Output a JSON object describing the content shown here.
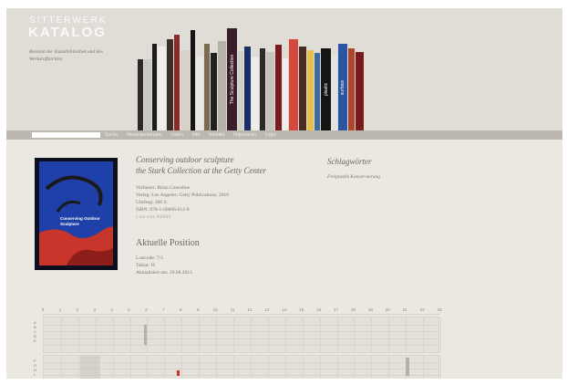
{
  "header": {
    "brand_line1": "SITTERWERK",
    "brand_line2": "KATALOG",
    "tagline": "Bestand der Kunstbibliothek und des Werkstoffarchivs"
  },
  "shelf_books": [
    {
      "color": "#2a2a2a",
      "label": ""
    },
    {
      "color": "#c9c7c2",
      "label": ""
    },
    {
      "color": "#1c1c1c",
      "label": ""
    },
    {
      "color": "#efeeea",
      "label": ""
    },
    {
      "color": "#3a2e25",
      "label": ""
    },
    {
      "color": "#8a2a2a",
      "label": ""
    },
    {
      "color": "#d7d3ca",
      "label": ""
    },
    {
      "color": "#141414",
      "label": ""
    },
    {
      "color": "#e9e7e2",
      "label": ""
    },
    {
      "color": "#7a6a50",
      "label": ""
    },
    {
      "color": "#20201e",
      "label": ""
    },
    {
      "color": "#b8b3a8",
      "label": ""
    },
    {
      "color": "#3a1f2a",
      "label": "The Sculpture Collection"
    },
    {
      "color": "#d1cfca",
      "label": ""
    },
    {
      "color": "#1a2f6a",
      "label": ""
    },
    {
      "color": "#efedea",
      "label": ""
    },
    {
      "color": "#2c2b28",
      "label": ""
    },
    {
      "color": "#c7c4bd",
      "label": ""
    },
    {
      "color": "#7a1c1c",
      "label": ""
    },
    {
      "color": "#efeeeb",
      "label": ""
    },
    {
      "color": "#d6483d",
      "label": ""
    },
    {
      "color": "#4a2a25",
      "label": ""
    },
    {
      "color": "#e2c24a",
      "label": ""
    },
    {
      "color": "#3b6ba0",
      "label": ""
    },
    {
      "color": "#151515",
      "label": "plastic"
    },
    {
      "color": "#e5e3de",
      "label": ""
    },
    {
      "color": "#2a55a2",
      "label": "surface"
    },
    {
      "color": "#b0452d",
      "label": ""
    },
    {
      "color": "#7a1a1a",
      "label": ""
    }
  ],
  "nav": {
    "search_placeholder": "",
    "items": [
      "Suche",
      "Neuerwerbungen",
      "Listen",
      "Info",
      "Kontakt",
      "Impressum",
      "Login"
    ]
  },
  "book": {
    "title_line1": "Conserving outdoor sculpture",
    "title_line2": "the Stark Collection at the Getty Center",
    "author": "Verfasser: Brian Considine",
    "publisher": "Verlag: Los Angeles: Getty Publications, 2010",
    "extent": "Umfang: 266 S.",
    "isbn": "ISBN: 978-1-60606-012-0",
    "link": "Link zum NEBIS",
    "cover_text": "Conserving Outdoor Sculpture",
    "cover_bg": "#1f40a8"
  },
  "position": {
    "heading": "Aktuelle Position",
    "lastcode": "Lastcode: 7/3",
    "shelf": "Tablar: H",
    "updated": "Aktualisiert am: 20.08.2013"
  },
  "keywords": {
    "heading": "Schlagwörter",
    "items": [
      "Freiplastik Konservierung"
    ]
  },
  "ruler": {
    "ticks": [
      "0",
      "1",
      "2",
      "3",
      "4",
      "5",
      "6",
      "7",
      "8",
      "9",
      "10",
      "11",
      "12",
      "13",
      "14",
      "15",
      "16",
      "17",
      "18",
      "19",
      "20",
      "21",
      "22",
      "23"
    ]
  },
  "grid1_labels": [
    "A",
    "B",
    "C",
    "D",
    "E"
  ],
  "grid2_labels": [
    "F",
    "G",
    "H",
    "I"
  ],
  "highlight_color": "#c8302a"
}
